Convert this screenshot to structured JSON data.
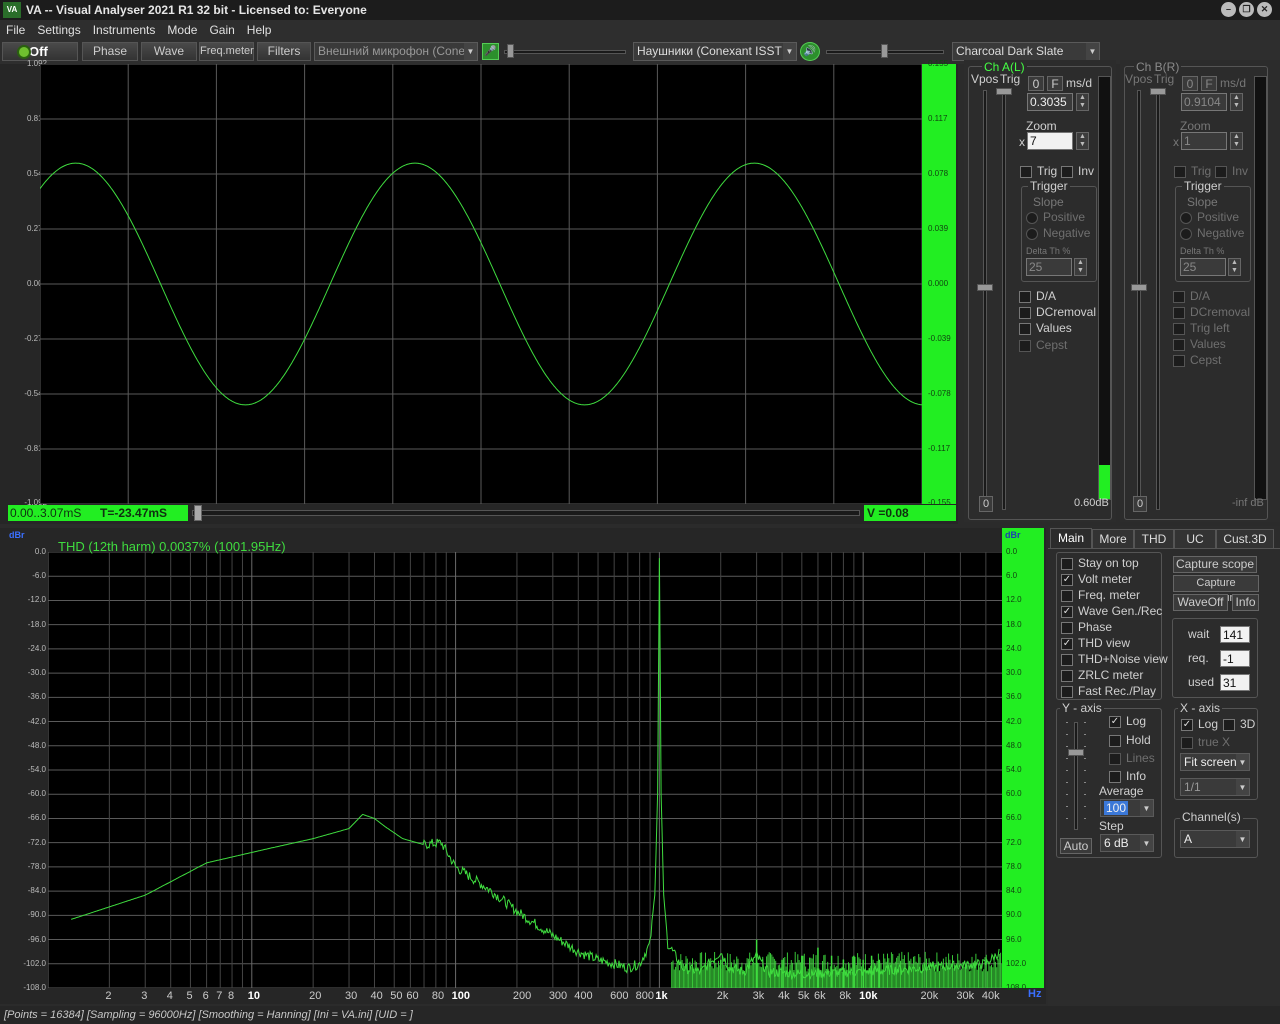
{
  "window": {
    "title": "VA -- Visual Analyser 2021 R1 32 bit - Licensed to: Everyone",
    "logo": "VA"
  },
  "menu": [
    "File",
    "Settings",
    "Instruments",
    "Mode",
    "Gain",
    "Help"
  ],
  "toolbar": {
    "power_label": "Off",
    "buttons": [
      "Phase",
      "Wave",
      "Freq.meter",
      "Filters"
    ],
    "input_device": "Внешний микрофон (Conexa",
    "output_device": "Наушники (Conexant ISST Au",
    "theme": "Charcoal Dark Slate"
  },
  "scope": {
    "left_ticks": [
      "1.092",
      "0.819",
      "0.546",
      "0.273",
      "0.000",
      "-0.273",
      "-0.546",
      "-0.819",
      "-1.092"
    ],
    "right_ticks": [
      "0.155",
      "0.117",
      "0.078",
      "0.039",
      "0.000",
      "-0.039",
      "-0.078",
      "-0.117",
      "-0.155"
    ],
    "time_range": "0.00..3.07mS",
    "t_readout": "T=-23.47mS",
    "v_readout": "V =0.08",
    "wave": {
      "amplitude": 0.6,
      "cycles": 2.6,
      "phase": 0.1
    }
  },
  "chA": {
    "title": "Ch A(L)",
    "vpos": "Vpos",
    "trig": "Trig",
    "btn0": "0",
    "btnF": "F",
    "msd_label": "ms/d",
    "msd_value": "0.3035",
    "zoom_label": "Zoom",
    "zoom_x": "x",
    "zoom_value": "7",
    "trig_cb": "Trig",
    "inv_cb": "Inv",
    "trigger_group": "Trigger",
    "slope": "Slope",
    "positive": "Positive",
    "negative": "Negative",
    "delta_label": "Delta Th %",
    "delta_value": "25",
    "checks": [
      "D/A",
      "DCremoval",
      "Values",
      "Cepst"
    ],
    "meter_value": "0.60dB",
    "meter_level": 0.08,
    "zero_btn": "0"
  },
  "chB": {
    "title": "Ch B(R)",
    "vpos": "Vpos",
    "trig": "Trig",
    "btn0": "0",
    "btnF": "F",
    "msd_label": "ms/d",
    "msd_value": "0.9104",
    "zoom_label": "Zoom",
    "zoom_x": "x",
    "zoom_value": "1",
    "trig_cb": "Trig",
    "inv_cb": "Inv",
    "trigger_group": "Trigger",
    "slope": "Slope",
    "positive": "Positive",
    "negative": "Negative",
    "delta_label": "Delta Th %",
    "delta_value": "25",
    "checks": [
      "D/A",
      "DCremoval",
      "Trig left",
      "Values",
      "Cepst"
    ],
    "meter_value": "-inf dB",
    "zero_btn": "0"
  },
  "spectrum": {
    "unit_left": "dBr",
    "unit_right": "dBr",
    "hz": "Hz",
    "thd_text": "THD (12th harm) 0.0037% (1001.95Hz)",
    "y_ticks": [
      "0.0",
      "-6.0",
      "-12.0",
      "-18.0",
      "-24.0",
      "-30.0",
      "-36.0",
      "-42.0",
      "-48.0",
      "-54.0",
      "-60.0",
      "-66.0",
      "-72.0",
      "-78.0",
      "-84.0",
      "-90.0",
      "-96.0",
      "-102.0",
      "-108.0"
    ],
    "y_ticks_right": [
      "0.0",
      "6.0",
      "12.0",
      "18.0",
      "24.0",
      "30.0",
      "36.0",
      "42.0",
      "48.0",
      "54.0",
      "60.0",
      "66.0",
      "72.0",
      "78.0",
      "84.0",
      "90.0",
      "96.0",
      "102.0",
      "108.0"
    ],
    "x_ticks": [
      {
        "f": 2,
        "t": "2"
      },
      {
        "f": 3,
        "t": "3"
      },
      {
        "f": 4,
        "t": "4"
      },
      {
        "f": 5,
        "t": "5"
      },
      {
        "f": 6,
        "t": "6"
      },
      {
        "f": 7,
        "t": "7"
      },
      {
        "f": 8,
        "t": "8"
      },
      {
        "f": 10,
        "t": "10",
        "b": true
      },
      {
        "f": 20,
        "t": "20"
      },
      {
        "f": 30,
        "t": "30"
      },
      {
        "f": 40,
        "t": "40"
      },
      {
        "f": 50,
        "t": "50"
      },
      {
        "f": 60,
        "t": "60"
      },
      {
        "f": 80,
        "t": "80"
      },
      {
        "f": 100,
        "t": "100",
        "b": true
      },
      {
        "f": 200,
        "t": "200"
      },
      {
        "f": 300,
        "t": "300"
      },
      {
        "f": 400,
        "t": "400"
      },
      {
        "f": 600,
        "t": "600"
      },
      {
        "f": 800,
        "t": "800"
      },
      {
        "f": 1000,
        "t": "1k",
        "b": true
      },
      {
        "f": 2000,
        "t": "2k"
      },
      {
        "f": 3000,
        "t": "3k"
      },
      {
        "f": 4000,
        "t": "4k"
      },
      {
        "f": 5000,
        "t": "5k"
      },
      {
        "f": 6000,
        "t": "6k"
      },
      {
        "f": 8000,
        "t": "8k"
      },
      {
        "f": 10000,
        "t": "10k",
        "b": true
      },
      {
        "f": 20000,
        "t": "20k"
      },
      {
        "f": 30000,
        "t": "30k"
      },
      {
        "f": 40000,
        "t": "40k"
      }
    ],
    "x_range": [
      1.0,
      48000
    ],
    "y_range": [
      -108,
      0
    ],
    "trace": [
      [
        1.3,
        -91
      ],
      [
        3,
        -85
      ],
      [
        6,
        -77
      ],
      [
        12,
        -73.5
      ],
      [
        20,
        -71
      ],
      [
        30,
        -68.5
      ],
      [
        35,
        -65
      ],
      [
        40,
        -66
      ],
      [
        45,
        -68
      ],
      [
        55,
        -71
      ],
      [
        70,
        -72.5
      ],
      [
        85,
        -72
      ],
      [
        100,
        -78
      ],
      [
        150,
        -84
      ],
      [
        200,
        -89
      ],
      [
        300,
        -95
      ],
      [
        400,
        -99
      ],
      [
        500,
        -101
      ],
      [
        600,
        -102
      ],
      [
        700,
        -103
      ],
      [
        800,
        -102
      ],
      [
        900,
        -97
      ],
      [
        950,
        -85
      ],
      [
        980,
        -60
      ],
      [
        1000,
        -1.5
      ],
      [
        1020,
        -60
      ],
      [
        1050,
        -85
      ],
      [
        1100,
        -97
      ],
      [
        1300,
        -103
      ],
      [
        1600,
        -104
      ],
      [
        2000,
        -99
      ],
      [
        2200,
        -103
      ],
      [
        2600,
        -104
      ],
      [
        3000,
        -100
      ],
      [
        3400,
        -104
      ],
      [
        5000,
        -104.5
      ],
      [
        10000,
        -104
      ],
      [
        20000,
        -103
      ],
      [
        40000,
        -102
      ],
      [
        47000,
        -99
      ]
    ],
    "harmonics": [
      [
        2000,
        -101
      ],
      [
        3000,
        -96
      ],
      [
        4000,
        -101
      ],
      [
        5000,
        -100
      ],
      [
        6000,
        -98
      ],
      [
        7000,
        -100
      ],
      [
        8000,
        -101
      ],
      [
        9000,
        -100
      ],
      [
        10000,
        -101
      ],
      [
        11000,
        -100
      ],
      [
        12000,
        -101
      ]
    ]
  },
  "tabs": [
    "Main",
    "More",
    "THD",
    "UC",
    "Cust.3D"
  ],
  "main": {
    "checks": [
      {
        "label": "Stay on top",
        "on": false
      },
      {
        "label": "Volt meter",
        "on": true
      },
      {
        "label": "Freq. meter",
        "on": false
      },
      {
        "label": "Wave Gen./Rec",
        "on": true
      },
      {
        "label": "Phase",
        "on": false
      },
      {
        "label": "THD view",
        "on": true
      },
      {
        "label": "THD+Noise view",
        "on": false
      },
      {
        "label": "ZRLC meter",
        "on": false
      },
      {
        "label": "Fast Rec./Play",
        "on": false
      }
    ],
    "capture_scope": "Capture scope",
    "capture_spectrum": "Capture spectrum",
    "waveoff": "WaveOff",
    "info": "Info",
    "wait_label": "wait",
    "wait_value": "141",
    "req_label": "req.",
    "req_value": "-1",
    "used_label": "used",
    "used_value": "31"
  },
  "yaxis": {
    "title": "Y - axis",
    "log": "Log",
    "hold": "Hold",
    "lines": "Lines",
    "info": "Info",
    "average_label": "Average",
    "average_value": "100",
    "step_label": "Step",
    "step_value": "6 dB",
    "auto": "Auto"
  },
  "xaxis": {
    "title": "X - axis",
    "log": "Log",
    "threed": "3D",
    "truex": "true X",
    "fit": "Fit screen",
    "ratio": "1/1"
  },
  "channels": {
    "title": "Channel(s)",
    "value": "A"
  },
  "status": "[Points = 16384]  [Sampling = 96000Hz]  [Smoothing = Hanning]  [Ini = VA.ini]  [UID = ]",
  "colors": {
    "trace": "#3fdc3f",
    "meter": "#22ee22",
    "grid": "#5a5a5a"
  }
}
